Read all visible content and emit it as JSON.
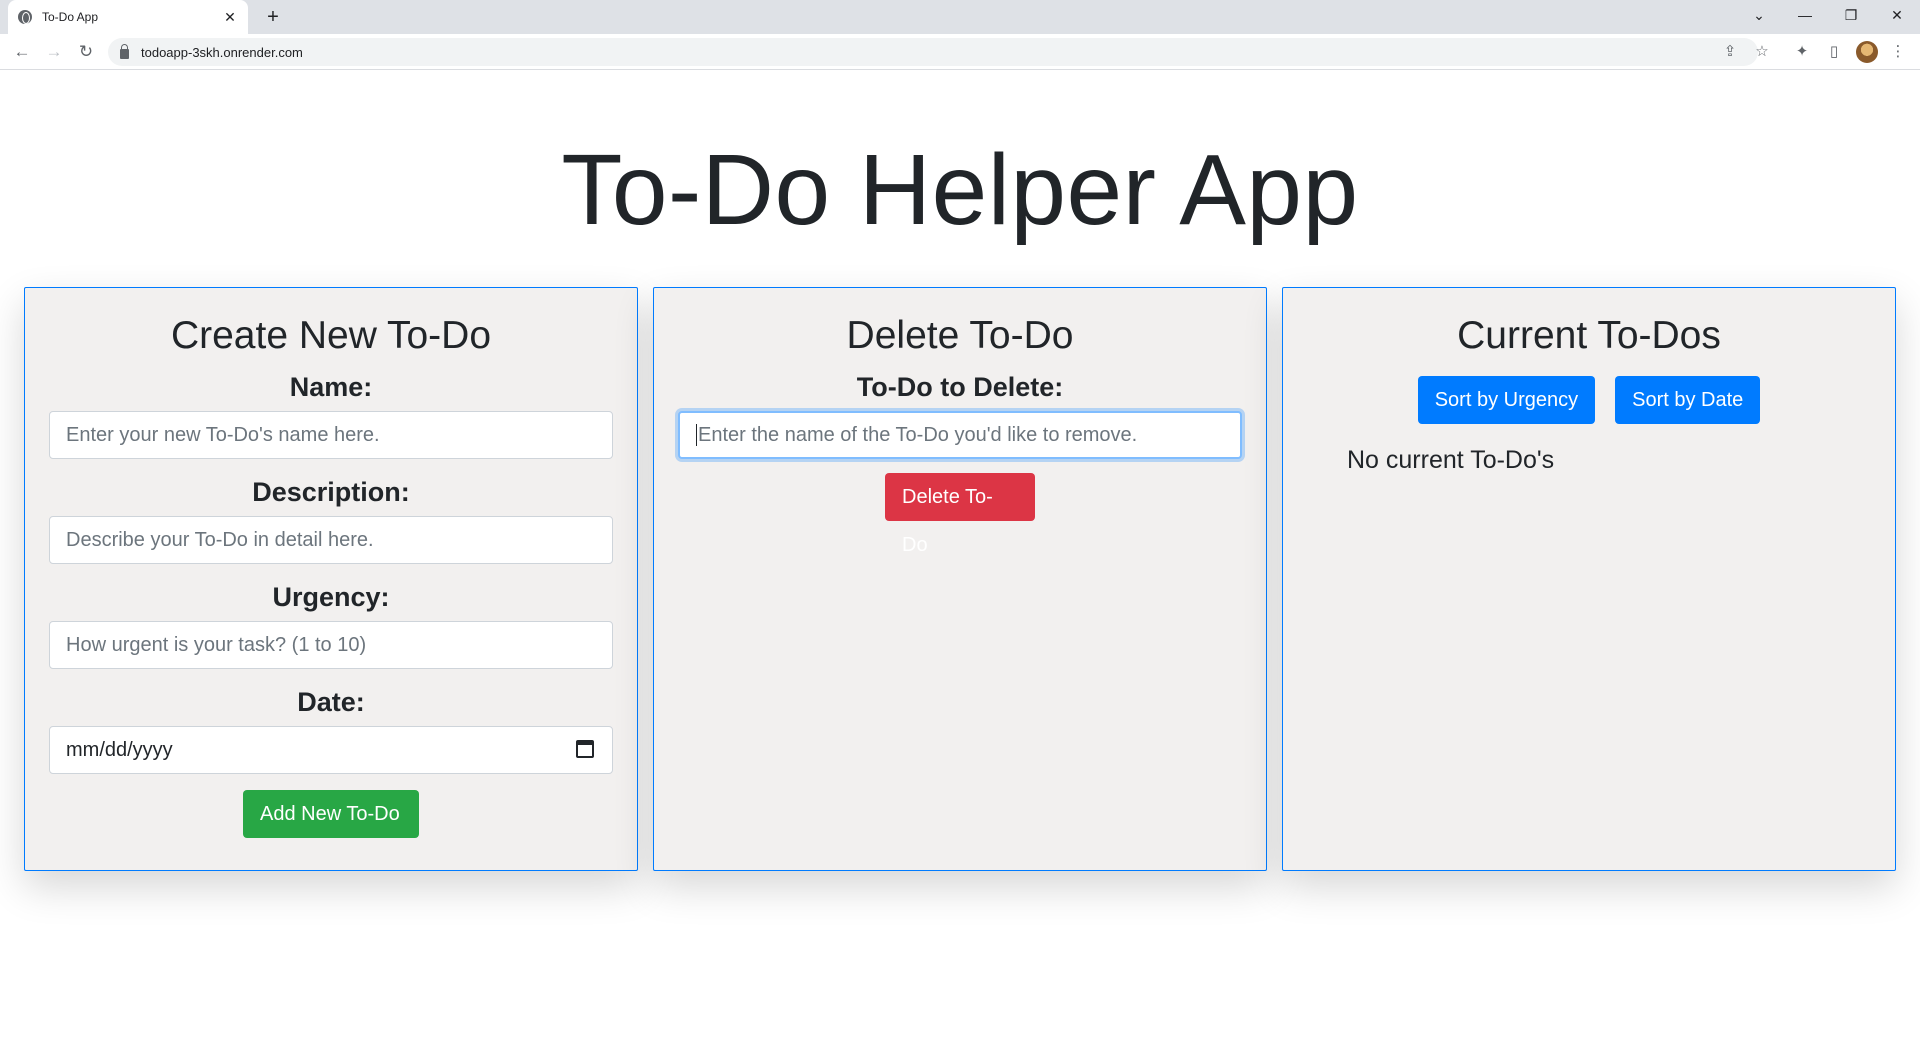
{
  "browser": {
    "tab_title": "To-Do App",
    "tab_close": "✕",
    "new_tab": "+",
    "url": "todoapp-3skh.onrender.com",
    "window_controls": {
      "dropdown": "⌄",
      "minimize": "—",
      "restore": "❐",
      "close": "✕"
    },
    "nav": {
      "back": "←",
      "forward": "→",
      "reload": "↻"
    },
    "toolbar_icons": {
      "share": "⇪",
      "bookmark": "☆",
      "extensions": "✦",
      "sidepanel": "▯",
      "menu": "⋮"
    }
  },
  "app": {
    "title": "To-Do Helper App"
  },
  "create": {
    "heading": "Create New To-Do",
    "name_label": "Name:",
    "name_placeholder": "Enter your new To-Do's name here.",
    "description_label": "Description:",
    "description_placeholder": "Describe your To-Do in detail here.",
    "urgency_label": "Urgency:",
    "urgency_placeholder": "How urgent is your task? (1 to 10)",
    "date_label": "Date:",
    "date_placeholder": "mm/dd/yyyy",
    "add_button": "Add New To-Do"
  },
  "delete": {
    "heading": "Delete To-Do",
    "label": "To-Do to Delete:",
    "placeholder": "Enter the name of the To-Do you'd like to remove.",
    "button": "Delete To-Do"
  },
  "current": {
    "heading": "Current To-Dos",
    "sort_urgency": "Sort by Urgency",
    "sort_date": "Sort by Date",
    "empty_text": "No current To-Do's"
  },
  "colors": {
    "card_border": "#007bff",
    "card_bg": "#f2f0ef",
    "add_button": "#28a745",
    "delete_button": "#dc3545",
    "sort_button": "#007bff"
  }
}
